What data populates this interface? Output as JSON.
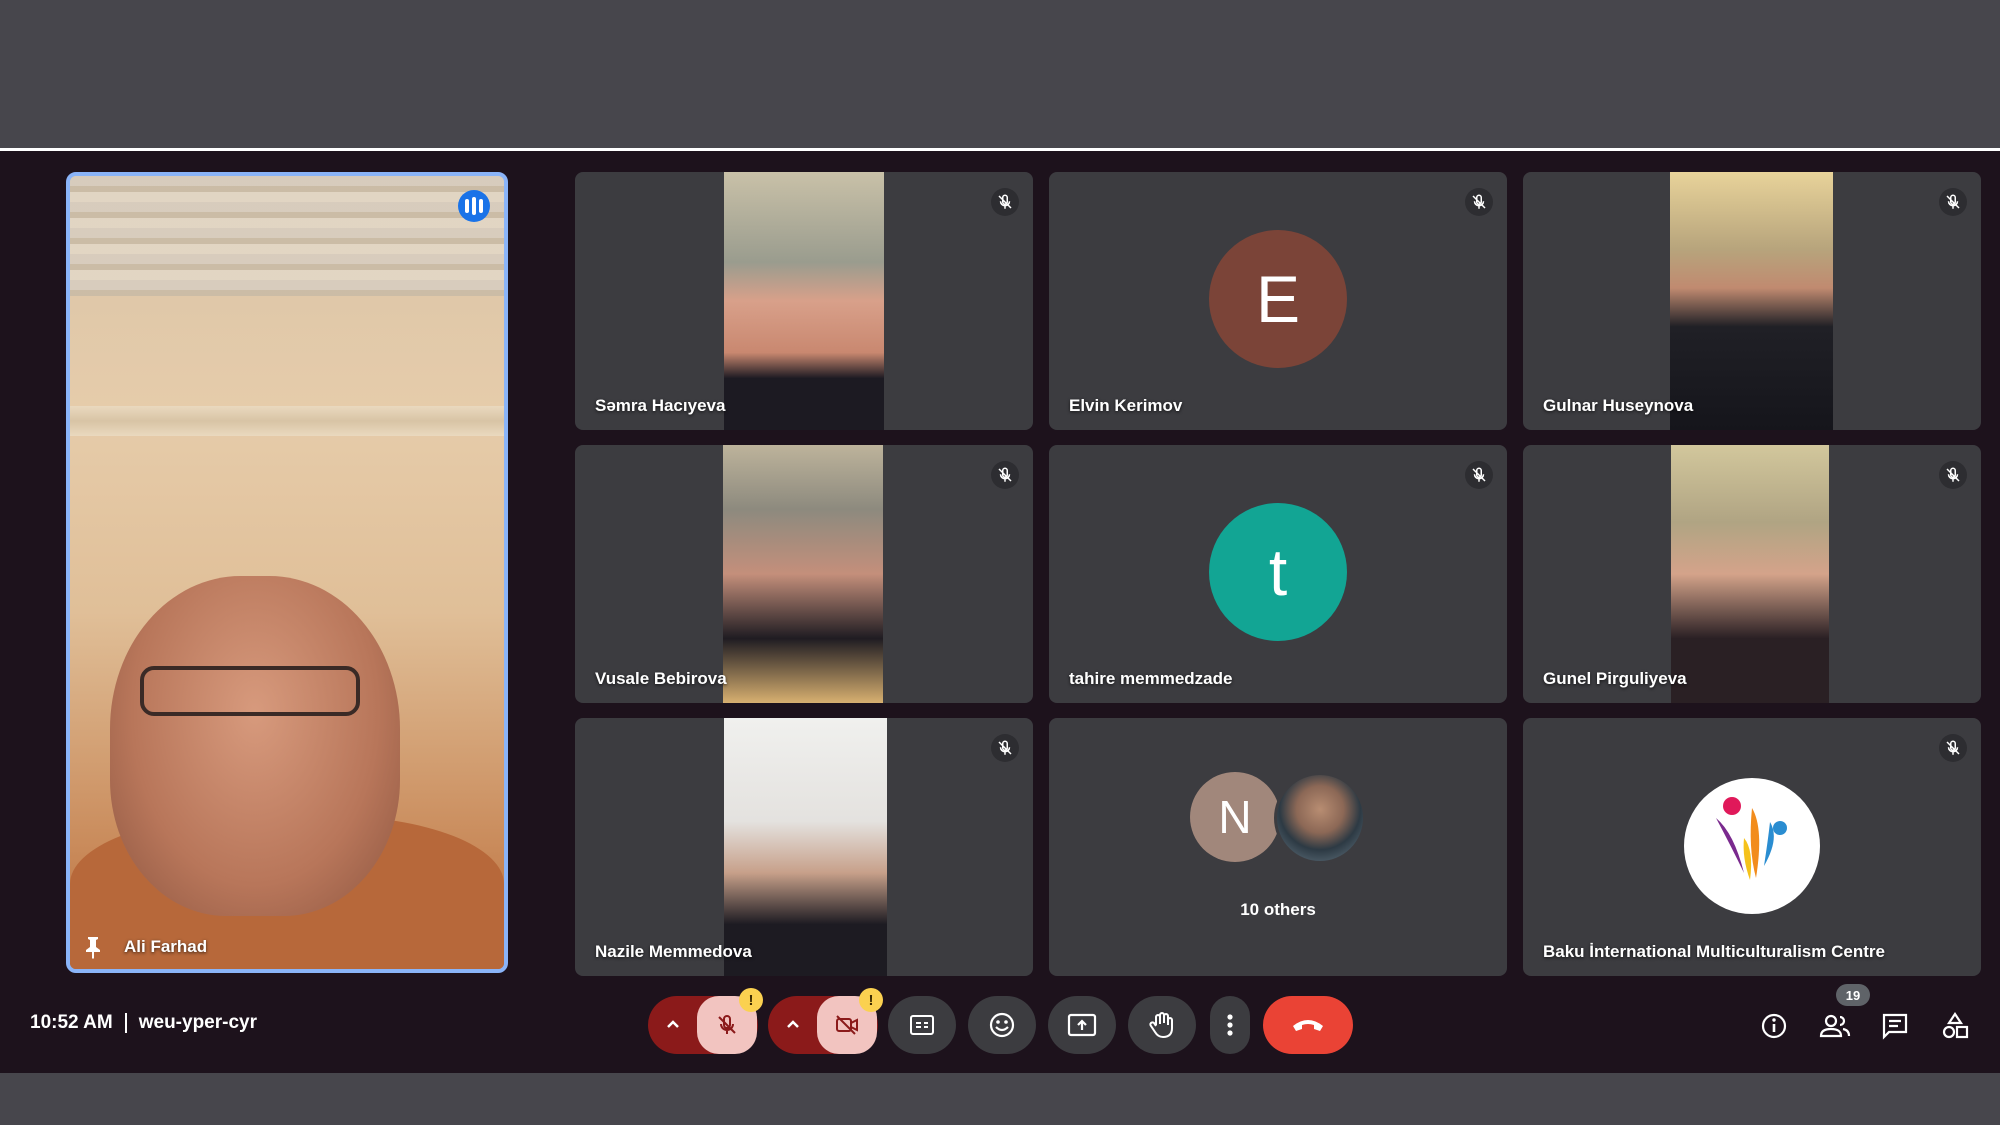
{
  "pinned": {
    "name": "Ali Farhad"
  },
  "tiles": [
    {
      "name": "Səmra Hacıyeva"
    },
    {
      "name": "Elvin Kerimov",
      "initial": "E",
      "color": "#7b4438"
    },
    {
      "name": "Gulnar Huseynova"
    },
    {
      "name": "Vusale Bebirova"
    },
    {
      "name": "tahire memmedzade",
      "initial": "t",
      "color": "#12a594"
    },
    {
      "name": "Gunel Pirguliyeva"
    },
    {
      "name": "Nazile Memmedova"
    },
    {
      "others_initial": "N",
      "others_label": "10 others"
    },
    {
      "name": "Baku İnternational Multiculturalism Centre"
    }
  ],
  "meeting": {
    "time": "10:52 AM",
    "code": "weu-yper-cyr"
  },
  "controls": {
    "mic_warning": "!",
    "cam_warning": "!"
  },
  "people_count": "19",
  "colors": {
    "stage": "#1d121c",
    "tile": "#3c3c40",
    "leave": "#ea4335",
    "highlight": "#8ab4f8"
  }
}
